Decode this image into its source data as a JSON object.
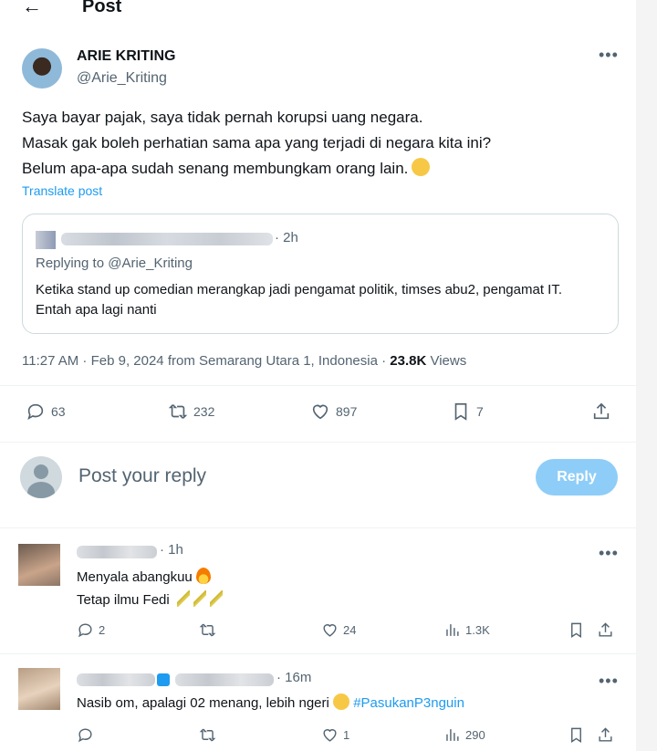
{
  "header": {
    "title": "Post"
  },
  "post": {
    "author_name": "ARIE KRITING",
    "author_handle": "@Arie_Kriting",
    "lines": [
      "Saya bayar pajak, saya tidak pernah korupsi uang negara.",
      "Masak gak boleh perhatian sama apa yang terjadi di negara kita ini?",
      "Belum apa-apa sudah senang membungkam orang lain."
    ],
    "translate_label": "Translate post",
    "quote": {
      "time": "· 2h",
      "replying_to": "Replying to @Arie_Kriting",
      "text": "Ketika stand up comedian merangkap jadi pengamat politik, timses abu2, pengamat IT. Entah apa lagi nanti"
    },
    "meta": {
      "time_date_place": "11:27 AM · Feb 9, 2024 from Semarang Utara 1, Indonesia ·",
      "views_count": "23.8K",
      "views_label": "Views"
    },
    "stats": {
      "replies": "63",
      "reposts": "232",
      "likes": "897",
      "bookmarks": "7"
    }
  },
  "reply_box": {
    "placeholder": "Post your reply",
    "button_label": "Reply"
  },
  "comments": [
    {
      "time": "· 1h",
      "line1": "Menyala abangkuu",
      "line2": "Tetap ilmu Fedi",
      "replies": "2",
      "reposts": "",
      "likes": "24",
      "views": "1.3K"
    },
    {
      "time": "· 16m",
      "text_main": "Nasib om, apalagi 02 menang, lebih ngeri",
      "hashtag": "#PasukanP3nguin",
      "replies": "",
      "reposts": "",
      "likes": "1",
      "views": "290"
    }
  ],
  "icons": [
    "back-arrow-icon",
    "more-icon",
    "reply-icon",
    "repost-icon",
    "like-icon",
    "bookmark-icon",
    "share-icon",
    "views-icon"
  ],
  "colors": {
    "accent": "#1d9bf0",
    "muted_text": "#536471",
    "reply_button": "#8ecdf8"
  }
}
